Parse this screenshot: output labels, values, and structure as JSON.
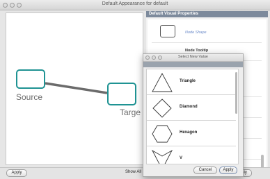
{
  "window": {
    "title": "Default Appearance for default"
  },
  "canvas": {
    "source_label": "Source",
    "target_label": "Targe"
  },
  "panel": {
    "header": "Default Visual Properties",
    "rows": [
      {
        "label": "Node Shape"
      },
      {
        "label": "Node Tooltip"
      }
    ]
  },
  "bottom": {
    "apply_label": "Apply",
    "show_all_label": "Show All",
    "apply_right_fragment": "ply"
  },
  "dialog": {
    "title": "Select New Value",
    "options": [
      {
        "name": "Triangle",
        "icon": "triangle-icon"
      },
      {
        "name": "Diamond",
        "icon": "diamond-icon"
      },
      {
        "name": "Hexagon",
        "icon": "hexagon-icon"
      },
      {
        "name": "V",
        "icon": "v-shape-icon"
      }
    ],
    "cancel_label": "Cancel",
    "apply_label": "Apply"
  },
  "colors": {
    "node_border": "#1f9393",
    "panel_header": "#7d8a9c",
    "edge": "#6b6b6b"
  }
}
